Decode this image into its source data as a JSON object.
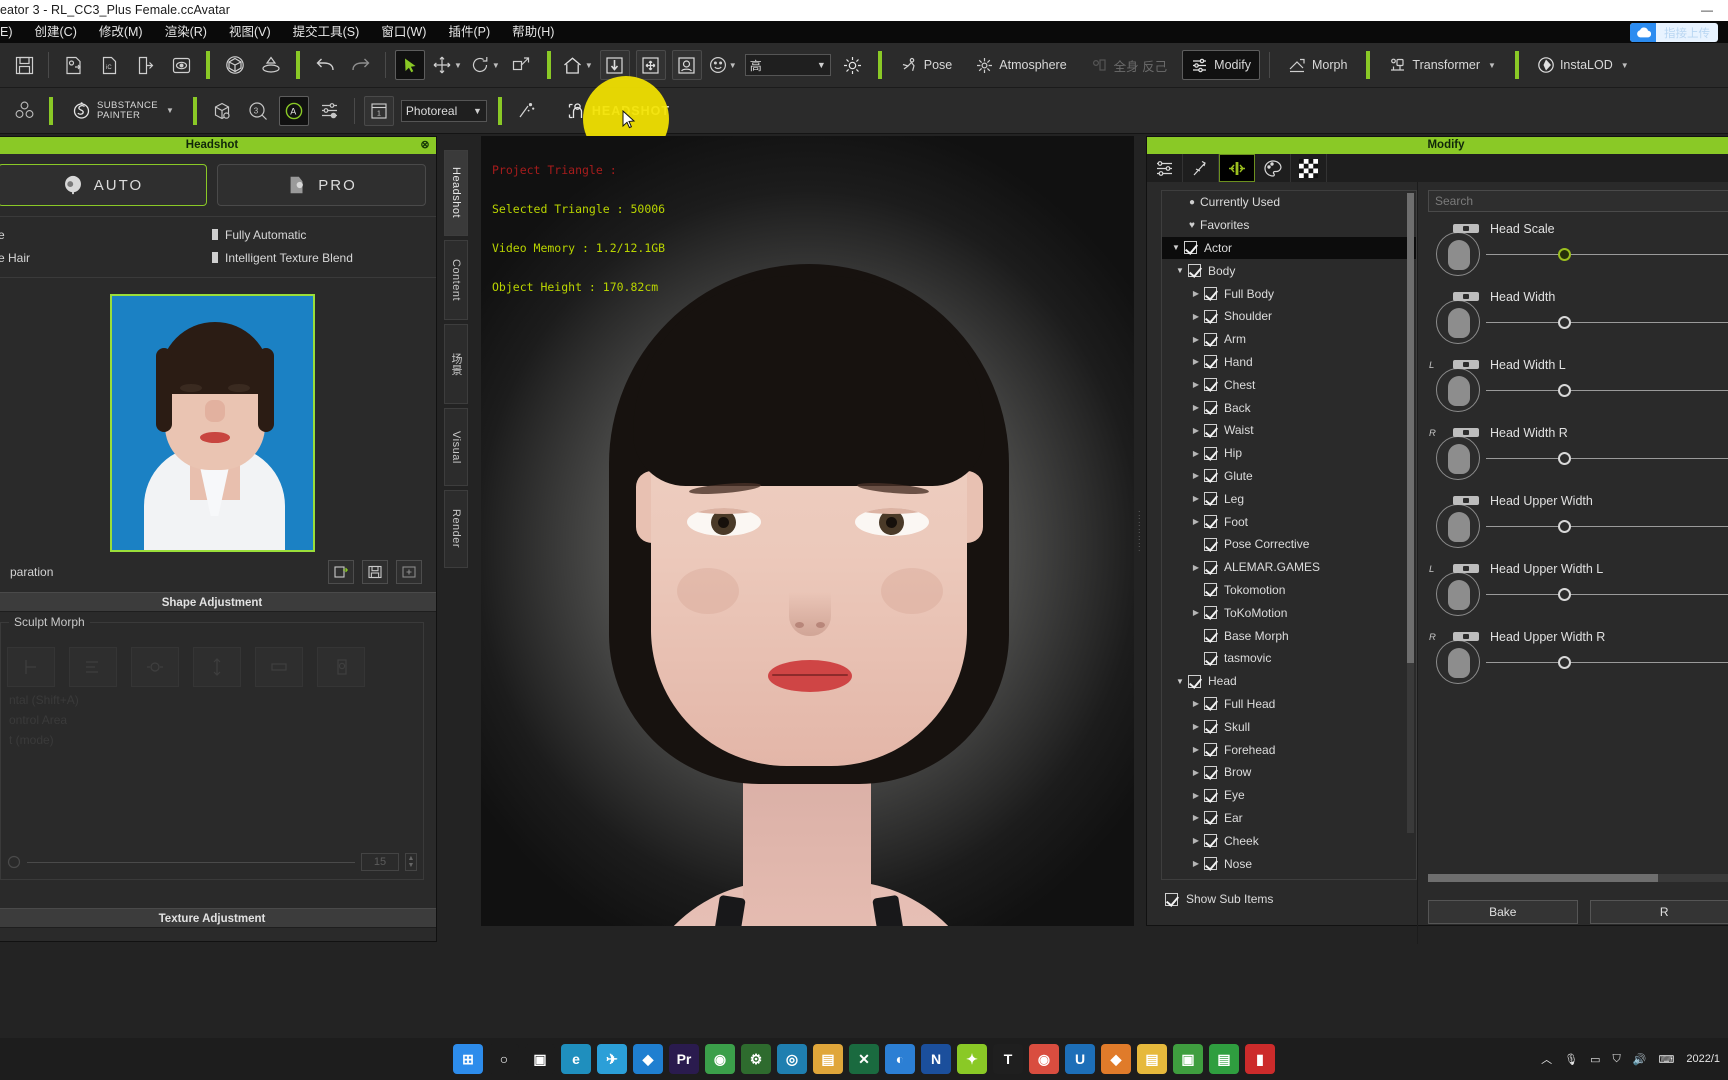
{
  "titlebar": {
    "text": "eator 3 - RL_CC3_Plus Female.ccAvatar",
    "minimize": "—",
    "maximize": "▢",
    "close": "✕"
  },
  "menubar": {
    "items": [
      {
        "label": "E)"
      },
      {
        "label": "创建(C)"
      },
      {
        "label": "修改(M)"
      },
      {
        "label": "渲染(R)"
      },
      {
        "label": "视图(V)"
      },
      {
        "label": "提交工具(S)"
      },
      {
        "label": "窗口(W)"
      },
      {
        "label": "插件(P)"
      },
      {
        "label": "帮助(H)"
      }
    ]
  },
  "upload_pill": {
    "icon": "cloud-icon",
    "label": "指接上传"
  },
  "toolbar_row1": {
    "buttons": [
      {
        "name": "save-button",
        "icon": "save-icon"
      },
      {
        "name": "import-avatar-button",
        "icon": "import-avatar-icon"
      },
      {
        "name": "import-character-button",
        "icon": "import-character-icon"
      },
      {
        "name": "export-button",
        "icon": "export-icon"
      },
      {
        "name": "preview-button",
        "icon": "preview-eye-icon"
      },
      {
        "name": "3d-object-button",
        "icon": "cube-icon"
      },
      {
        "name": "terrain-button",
        "icon": "terrain-icon"
      },
      {
        "name": "undo-button",
        "icon": "undo-icon"
      },
      {
        "name": "redo-button",
        "icon": "redo-icon"
      },
      {
        "name": "select-tool-button",
        "icon": "cursor-arrow-icon"
      },
      {
        "name": "move-tool-button",
        "icon": "move-icon"
      },
      {
        "name": "rotate-tool-button",
        "icon": "rotate-icon"
      },
      {
        "name": "scale-tool-button",
        "icon": "scale-icon"
      },
      {
        "name": "home-view-button",
        "icon": "home-icon"
      },
      {
        "name": "person-view-button",
        "icon": "person-down-icon"
      },
      {
        "name": "fit-view-button",
        "icon": "fit-arrows-icon"
      },
      {
        "name": "face-view-button",
        "icon": "face-frame-icon"
      },
      {
        "name": "expression-button",
        "icon": "smiley-icon"
      }
    ],
    "quality_combo": {
      "value": "高",
      "caret": "▼"
    },
    "light_button": {
      "name": "light-button",
      "icon": "sun-icon"
    },
    "pose_label": "Pose",
    "atmosphere_label": "Atmosphere",
    "dim_label": "全身 反己",
    "modify_label": "Modify",
    "morph_label": "Morph",
    "transformer_label": "Transformer",
    "instalod_label": "InstaLOD"
  },
  "toolbar_row2": {
    "buttons": [
      {
        "name": "material-button",
        "icon": "material-balls-icon"
      },
      {
        "name": "substance-painter-button",
        "icon": "substance-s-icon",
        "label": "SUBSTANCE\nPAINTER"
      },
      {
        "name": "package-button",
        "icon": "package-icon"
      },
      {
        "name": "3dxchange-button",
        "icon": "three-d-icon"
      },
      {
        "name": "accessory-button",
        "icon": "a-circle-icon"
      },
      {
        "name": "settings-sliders-button",
        "icon": "sliders-icon"
      },
      {
        "name": "frame-button",
        "icon": "frame-1-icon"
      }
    ],
    "render_combo": {
      "value": "Photoreal",
      "caret": "▼"
    },
    "sparkle_button": {
      "name": "sparkle-button",
      "icon": "sparkle-icon"
    },
    "headshot_label": "HEADSHOT",
    "headshot_icon": "headshot-icon"
  },
  "headshot_panel": {
    "title": "Headshot",
    "close": "⊗",
    "modes": [
      {
        "label": "AUTO",
        "icon": "auto-head-icon",
        "selected": true
      },
      {
        "label": "PRO",
        "icon": "pro-head-icon",
        "selected": false
      }
    ],
    "options_left": [
      "e",
      "e Hair"
    ],
    "options_right": [
      "Fully Automatic",
      "Intelligent Texture Blend"
    ],
    "photo_alt": "source-portrait-photo",
    "actions_link": "paration",
    "action_buttons": [
      {
        "name": "load-image-button",
        "icon": "load-image-icon"
      },
      {
        "name": "save-image-button",
        "icon": "save-image-icon"
      },
      {
        "name": "reset-image-button",
        "icon": "reset-image-icon"
      }
    ],
    "shape_adjustment_title": "Shape Adjustment",
    "sculpt_morph_label": "Sculpt Morph",
    "dim_lines": [
      "ntal (Shift+A)",
      "ontrol Area",
      "t (mode)"
    ],
    "slider_value": "15",
    "texture_adjustment_title": "Texture Adjustment"
  },
  "vertical_tabs": [
    {
      "label": "Headshot",
      "active": true
    },
    {
      "label": "Content",
      "active": false
    },
    {
      "label": "场景",
      "active": false
    },
    {
      "label": "Visual",
      "active": false
    },
    {
      "label": "Render",
      "active": false
    }
  ],
  "viewport": {
    "overlay": [
      {
        "text": "Project Triangle : ",
        "color": "#a61c1c"
      },
      {
        "text": "Selected Triangle : 50006",
        "color": "#b9d400"
      },
      {
        "text": "Video Memory : 1.2/12.1GB",
        "color": "#b9d400"
      },
      {
        "text": "Object Height : 170.82cm",
        "color": "#b9d400"
      }
    ]
  },
  "modify_panel": {
    "title": "Modify",
    "tabs": [
      {
        "name": "tab-attributes",
        "icon": "sliders-icon",
        "active": false
      },
      {
        "name": "tab-motion",
        "icon": "motion-icon",
        "active": false
      },
      {
        "name": "tab-morph",
        "icon": "morph-arrows-icon",
        "active": true
      },
      {
        "name": "tab-material",
        "icon": "palette-icon",
        "active": false
      },
      {
        "name": "tab-texture",
        "icon": "checker-icon",
        "active": false
      }
    ],
    "tree": [
      {
        "label": "Currently Used",
        "indent": 0,
        "arrow": "",
        "icon": "dot",
        "checkbox": false,
        "selected": false
      },
      {
        "label": "Favorites",
        "indent": 0,
        "arrow": "",
        "icon": "heart",
        "checkbox": false,
        "selected": false
      },
      {
        "label": "Actor",
        "indent": 0,
        "arrow": "down",
        "icon": "",
        "checkbox": true,
        "selected": true
      },
      {
        "label": "Body",
        "indent": 1,
        "arrow": "down",
        "icon": "",
        "checkbox": true,
        "selected": false
      },
      {
        "label": "Full Body",
        "indent": 2,
        "arrow": "right",
        "icon": "",
        "checkbox": true,
        "selected": false
      },
      {
        "label": "Shoulder",
        "indent": 2,
        "arrow": "right",
        "icon": "",
        "checkbox": true,
        "selected": false
      },
      {
        "label": "Arm",
        "indent": 2,
        "arrow": "right",
        "icon": "",
        "checkbox": true,
        "selected": false
      },
      {
        "label": "Hand",
        "indent": 2,
        "arrow": "right",
        "icon": "",
        "checkbox": true,
        "selected": false
      },
      {
        "label": "Chest",
        "indent": 2,
        "arrow": "right",
        "icon": "",
        "checkbox": true,
        "selected": false
      },
      {
        "label": "Back",
        "indent": 2,
        "arrow": "right",
        "icon": "",
        "checkbox": true,
        "selected": false
      },
      {
        "label": "Waist",
        "indent": 2,
        "arrow": "right",
        "icon": "",
        "checkbox": true,
        "selected": false
      },
      {
        "label": "Hip",
        "indent": 2,
        "arrow": "right",
        "icon": "",
        "checkbox": true,
        "selected": false
      },
      {
        "label": "Glute",
        "indent": 2,
        "arrow": "right",
        "icon": "",
        "checkbox": true,
        "selected": false
      },
      {
        "label": "Leg",
        "indent": 2,
        "arrow": "right",
        "icon": "",
        "checkbox": true,
        "selected": false
      },
      {
        "label": "Foot",
        "indent": 2,
        "arrow": "right",
        "icon": "",
        "checkbox": true,
        "selected": false
      },
      {
        "label": "Pose Corrective",
        "indent": 2,
        "arrow": "",
        "icon": "",
        "checkbox": true,
        "selected": false
      },
      {
        "label": "ALEMAR.GAMES",
        "indent": 2,
        "arrow": "right",
        "icon": "",
        "checkbox": true,
        "selected": false
      },
      {
        "label": "Tokomotion",
        "indent": 2,
        "arrow": "",
        "icon": "",
        "checkbox": true,
        "selected": false
      },
      {
        "label": "ToKoMotion",
        "indent": 2,
        "arrow": "right",
        "icon": "",
        "checkbox": true,
        "selected": false
      },
      {
        "label": "Base Morph",
        "indent": 2,
        "arrow": "",
        "icon": "",
        "checkbox": true,
        "selected": false
      },
      {
        "label": "tasmovic",
        "indent": 2,
        "arrow": "",
        "icon": "",
        "checkbox": true,
        "selected": false
      },
      {
        "label": "Head",
        "indent": 1,
        "arrow": "down",
        "icon": "",
        "checkbox": true,
        "selected": false
      },
      {
        "label": "Full Head",
        "indent": 2,
        "arrow": "right",
        "icon": "",
        "checkbox": true,
        "selected": false
      },
      {
        "label": "Skull",
        "indent": 2,
        "arrow": "right",
        "icon": "",
        "checkbox": true,
        "selected": false
      },
      {
        "label": "Forehead",
        "indent": 2,
        "arrow": "right",
        "icon": "",
        "checkbox": true,
        "selected": false
      },
      {
        "label": "Brow",
        "indent": 2,
        "arrow": "right",
        "icon": "",
        "checkbox": true,
        "selected": false
      },
      {
        "label": "Eye",
        "indent": 2,
        "arrow": "right",
        "icon": "",
        "checkbox": true,
        "selected": false
      },
      {
        "label": "Ear",
        "indent": 2,
        "arrow": "right",
        "icon": "",
        "checkbox": true,
        "selected": false
      },
      {
        "label": "Cheek",
        "indent": 2,
        "arrow": "right",
        "icon": "",
        "checkbox": true,
        "selected": false
      },
      {
        "label": "Nose",
        "indent": 2,
        "arrow": "right",
        "icon": "",
        "checkbox": true,
        "selected": false
      }
    ],
    "show_sub_items_label": "Show Sub Items",
    "search_placeholder": "Search",
    "sliders": [
      {
        "label": "Head Scale",
        "side": "",
        "knob_pct": 34,
        "highlighted": true
      },
      {
        "label": "Head Width",
        "side": "",
        "knob_pct": 34,
        "highlighted": false
      },
      {
        "label": "Head Width L",
        "side": "L",
        "knob_pct": 34,
        "highlighted": false
      },
      {
        "label": "Head Width R",
        "side": "R",
        "knob_pct": 34,
        "highlighted": false
      },
      {
        "label": "Head Upper Width",
        "side": "",
        "knob_pct": 34,
        "highlighted": false
      },
      {
        "label": "Head Upper Width L",
        "side": "L",
        "knob_pct": 34,
        "highlighted": false
      },
      {
        "label": "Head Upper Width R",
        "side": "R",
        "knob_pct": 34,
        "highlighted": false
      }
    ],
    "buttons": [
      {
        "label": "Bake",
        "name": "bake-button"
      },
      {
        "label": "R",
        "name": "reset-button"
      }
    ]
  },
  "taskbar": {
    "items": [
      {
        "name": "start-button",
        "glyph": "⊞",
        "color": "#2d8ceb"
      },
      {
        "name": "search-button",
        "glyph": "○",
        "color": "#1d1d1d"
      },
      {
        "name": "task-view-button",
        "glyph": "▣",
        "color": "#1d1d1d"
      },
      {
        "name": "edge-button",
        "glyph": "e",
        "color": "#1f8fbe"
      },
      {
        "name": "telegram-button",
        "glyph": "✈",
        "color": "#2b9fd8"
      },
      {
        "name": "app-blue-button",
        "glyph": "◆",
        "color": "#1f7fd0"
      },
      {
        "name": "premiere-button",
        "glyph": "Pr",
        "color": "#2a1b4e"
      },
      {
        "name": "chrome-alt-button",
        "glyph": "◉",
        "color": "#3b9f4a"
      },
      {
        "name": "settings-green-button",
        "glyph": "⚙",
        "color": "#2e6b2e"
      },
      {
        "name": "recorder-button",
        "glyph": "◎",
        "color": "#1f7fb0"
      },
      {
        "name": "folder-orange-button",
        "glyph": "▤",
        "color": "#e0a63a"
      },
      {
        "name": "x-app-button",
        "glyph": "✕",
        "color": "#1a6a3f"
      },
      {
        "name": "blue-circle-button",
        "glyph": "◐",
        "color": "#2c7fd4"
      },
      {
        "name": "n-app-button",
        "glyph": "N",
        "color": "#1b4f9c"
      },
      {
        "name": "green-leaf-button",
        "glyph": "✦",
        "color": "#8ac926"
      },
      {
        "name": "t-app-button",
        "glyph": "T",
        "color": "#1f1f1f"
      },
      {
        "name": "chrome-button",
        "glyph": "◉",
        "color": "#d94d3f"
      },
      {
        "name": "u-app-button",
        "glyph": "U",
        "color": "#1d6fb8"
      },
      {
        "name": "orange-app-button",
        "glyph": "◆",
        "color": "#e07b2a"
      },
      {
        "name": "folder-button",
        "glyph": "▤",
        "color": "#e6b93c"
      },
      {
        "name": "green-app-button",
        "glyph": "▣",
        "color": "#3f9e3f"
      },
      {
        "name": "wechat-button",
        "glyph": "▤",
        "color": "#2f9e3f"
      },
      {
        "name": "red-app-button",
        "glyph": "▮",
        "color": "#cc2b2b"
      }
    ],
    "tray": {
      "chevron": "︿",
      "icons": [
        "microphone-icon",
        "mic2-icon",
        "monitor-icon",
        "shield-icon",
        "volume-icon",
        "keyboard-icon"
      ],
      "clock": "2022/1"
    }
  }
}
